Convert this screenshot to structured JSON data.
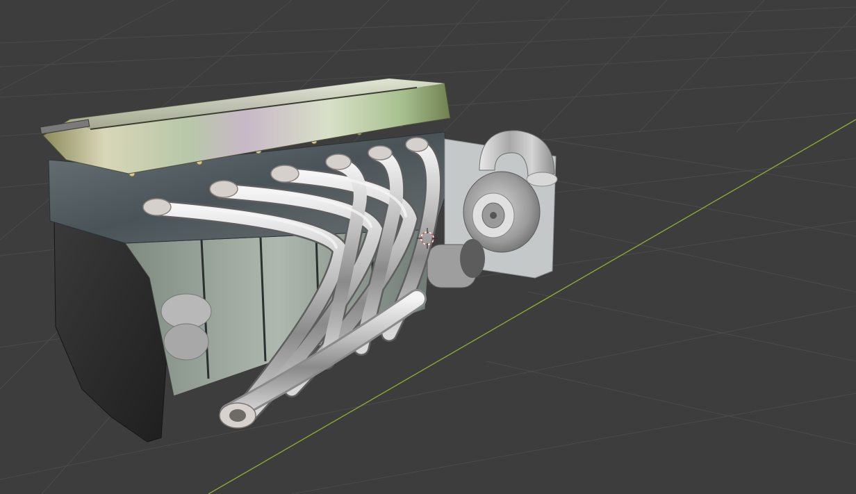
{
  "viewport": {
    "background_color": "#3d3d3d",
    "grid_color": "#4a4a4a",
    "x_axis_color": "#8fb032"
  },
  "scene": {
    "object": "engine-model",
    "parts": [
      "cylinder-head",
      "valve-cover",
      "engine-block",
      "oil-pan",
      "exhaust-header",
      "turbocharger",
      "alternator"
    ],
    "colors": {
      "chrome": "#c8c8c8",
      "block": "#5a6468",
      "oil_pan": "#2c2c2c",
      "turbo": "#a9a9a9"
    }
  },
  "origin_marker": {
    "icon": "3d-cursor-icon",
    "color": "#e05040"
  }
}
